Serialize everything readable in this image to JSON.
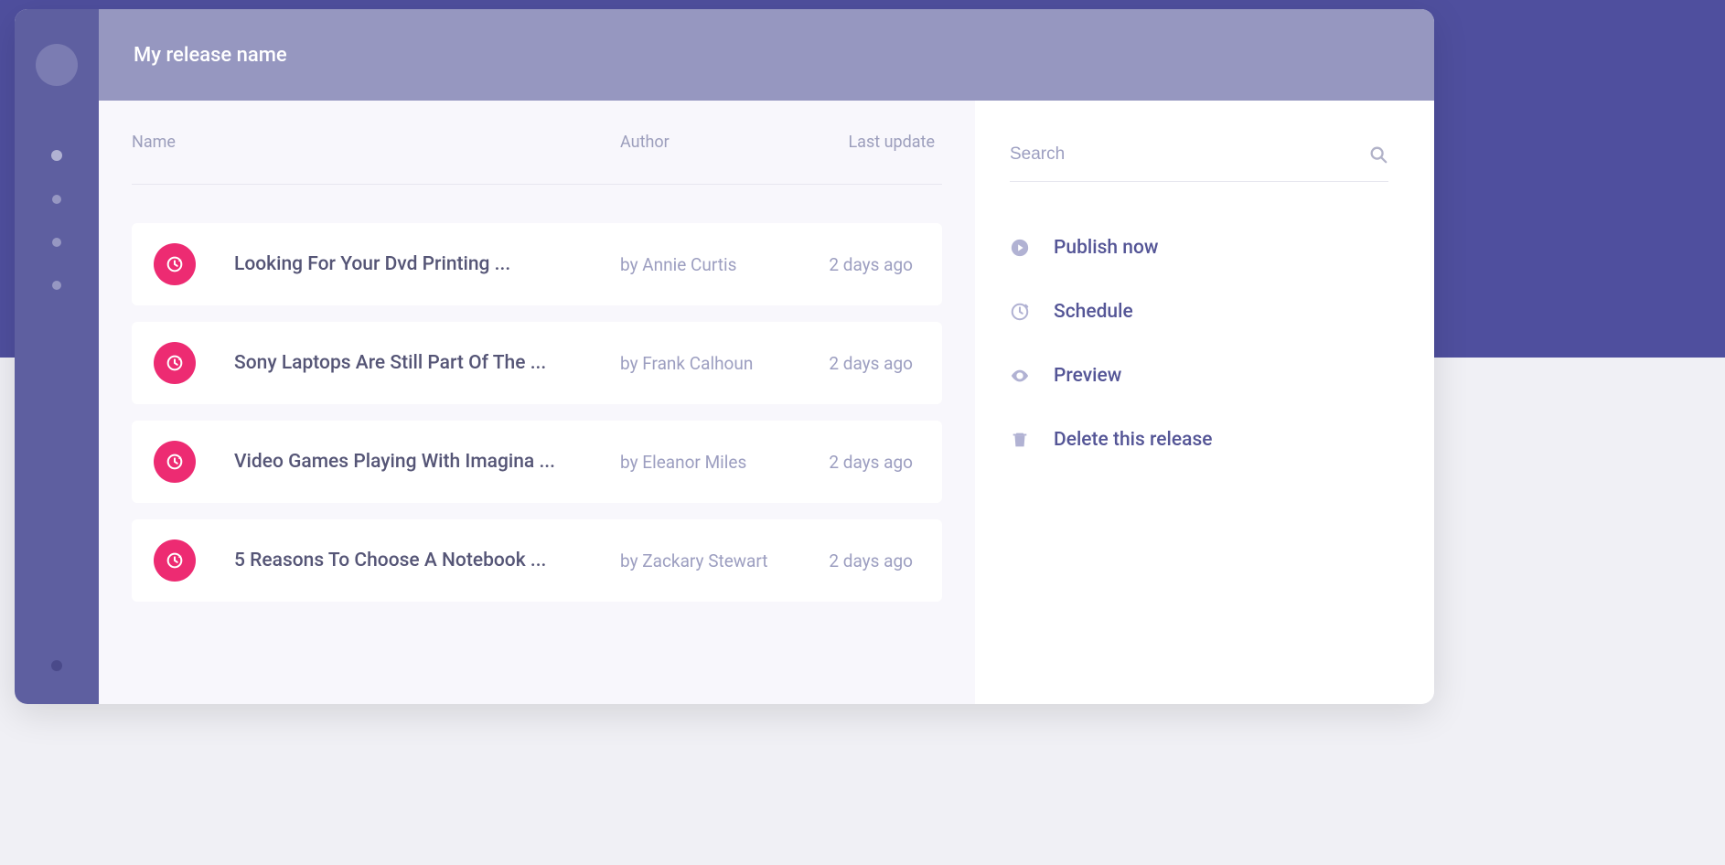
{
  "topbar": {
    "title": "My release name"
  },
  "sidebar": {
    "nav_items": [
      "nav-1",
      "nav-2",
      "nav-3",
      "nav-4"
    ],
    "bottom_item": "settings"
  },
  "table": {
    "headers": {
      "name": "Name",
      "author": "Author",
      "updated": "Last update"
    },
    "rows": [
      {
        "name": "Looking For Your Dvd Printing ...",
        "author": "by Annie Curtis",
        "updated": "2 days ago"
      },
      {
        "name": "Sony Laptops Are Still Part Of The ...",
        "author": "by Frank Calhoun",
        "updated": "2 days ago"
      },
      {
        "name": "Video Games Playing With Imagina ...",
        "author": "by Eleanor Miles",
        "updated": "2 days ago"
      },
      {
        "name": "5 Reasons To Choose A Notebook ...",
        "author": "by Zackary Stewart",
        "updated": "2 days ago"
      }
    ]
  },
  "search": {
    "placeholder": "Search"
  },
  "actions": {
    "publish": "Publish now",
    "schedule": "Schedule",
    "preview": "Preview",
    "delete": "Delete this release"
  },
  "colors": {
    "brand": "#4f4f9e",
    "sidebar": "#5e5fa0",
    "accent": "#ed2b72",
    "muted": "#9c9ec0",
    "text": "#555576"
  }
}
